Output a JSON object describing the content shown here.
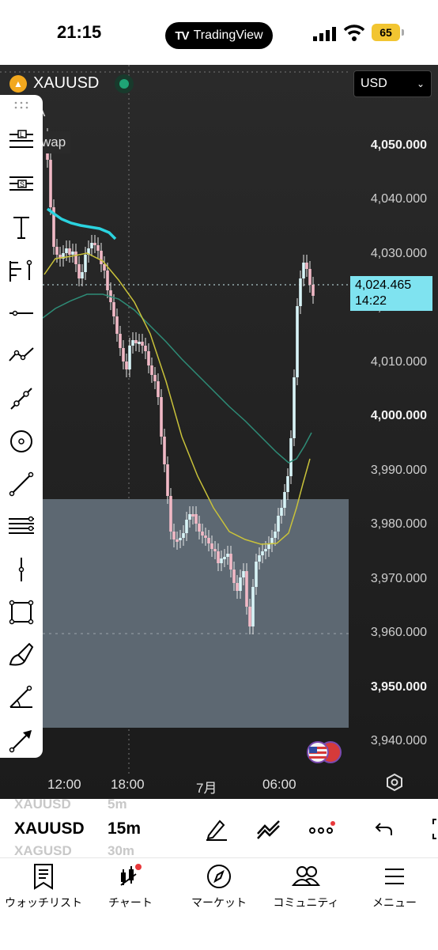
{
  "status": {
    "time": "21:15",
    "app_pill": "TradingView",
    "battery": "65"
  },
  "chart": {
    "symbol": "XAUUSD",
    "currency": "USD",
    "indicator_1": "A",
    "indicator_2": "wap",
    "price_labels": [
      {
        "text": "4,050.000",
        "bold": true
      },
      {
        "text": "4,040.000",
        "bold": false
      },
      {
        "text": "4,030.000",
        "bold": false
      },
      {
        "text": "4,020.000",
        "bold": false
      },
      {
        "text": "4,010.000",
        "bold": false
      },
      {
        "text": "4,000.000",
        "bold": true
      },
      {
        "text": "3,990.000",
        "bold": false
      },
      {
        "text": "3,980.000",
        "bold": false
      },
      {
        "text": "3,970.000",
        "bold": false
      },
      {
        "text": "3,960.000",
        "bold": false
      },
      {
        "text": "3,950.000",
        "bold": true
      },
      {
        "text": "3,940.000",
        "bold": false
      }
    ],
    "current_price": "4,024.465",
    "countdown": "14:22",
    "time_labels": [
      "12:00",
      "18:00",
      "7月",
      "06:00"
    ],
    "colors": {
      "background": "#1b1b1b",
      "zone": "#5d6872",
      "vwap": "#2bd3df",
      "ma_yellow": "#c9c23a",
      "ma_green": "#2e8c77",
      "current_price_bg": "#7fe3f0"
    }
  },
  "toolbar": {
    "tools": [
      "long-position-icon",
      "short-position-icon",
      "text-icon",
      "fib-icon",
      "horizontal-line-icon",
      "path-icon",
      "trend-path-icon",
      "circle-icon",
      "trend-line-icon",
      "parallel-channel-icon",
      "vertical-line-icon",
      "rectangle-icon",
      "brush-icon",
      "angle-icon",
      "arrow-icon"
    ]
  },
  "bottom": {
    "symbol": "XAUUSD",
    "timeframe": "15m",
    "ghost_above_symbol": "XAUUSD",
    "ghost_above_tf": "5m",
    "ghost_below_symbol": "XAGUSD",
    "ghost_below_tf": "30m"
  },
  "tabs": [
    {
      "label": "ウォッチリスト",
      "icon": "watchlist-icon"
    },
    {
      "label": "チャート",
      "icon": "chart-icon"
    },
    {
      "label": "マーケット",
      "icon": "compass-icon"
    },
    {
      "label": "コミュニティ",
      "icon": "community-icon"
    },
    {
      "label": "メニュー",
      "icon": "menu-icon"
    }
  ]
}
